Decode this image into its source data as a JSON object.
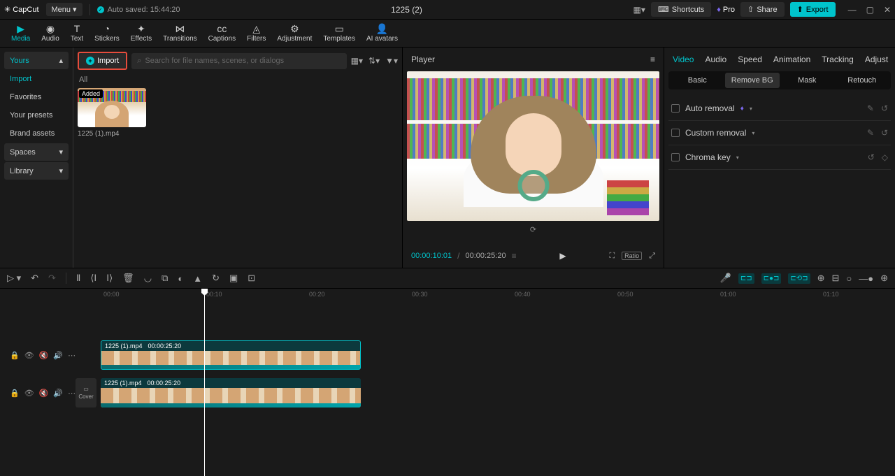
{
  "titlebar": {
    "logo": "CapCut",
    "menu": "Menu",
    "autosave": "Auto saved: 15:44:20",
    "project_title": "1225 (2)",
    "shortcuts": "Shortcuts",
    "pro": "Pro",
    "share": "Share",
    "export": "Export"
  },
  "toolbar": {
    "items": [
      "Media",
      "Audio",
      "Text",
      "Stickers",
      "Effects",
      "Transitions",
      "Captions",
      "Filters",
      "Adjustment",
      "Templates",
      "AI avatars"
    ],
    "active_index": 0
  },
  "sidebar": {
    "yours": "Yours",
    "items": [
      "Import",
      "Favorites",
      "Your presets",
      "Brand assets"
    ],
    "active_index": 0,
    "spaces": "Spaces",
    "library": "Library"
  },
  "media": {
    "import_btn": "Import",
    "search_placeholder": "Search for file names, scenes, or dialogs",
    "all_label": "All",
    "thumb_badge": "Added",
    "thumb_name": "1225 (1).mp4"
  },
  "player": {
    "title": "Player",
    "time_current": "00:00:10:01",
    "time_total": "00:00:25:20",
    "ratio": "Ratio"
  },
  "inspector": {
    "tabs": [
      "Video",
      "Audio",
      "Speed",
      "Animation",
      "Tracking",
      "Adjust"
    ],
    "active_tab": 0,
    "subtabs": [
      "Basic",
      "Remove BG",
      "Mask",
      "Retouch"
    ],
    "active_subtab": 1,
    "auto_removal": "Auto removal",
    "custom_removal": "Custom removal",
    "chroma_key": "Chroma key"
  },
  "timeline": {
    "ruler": [
      "00:00",
      "00:10",
      "00:20",
      "00:30",
      "00:40",
      "00:50",
      "01:00",
      "01:10"
    ],
    "clip1_name": "1225 (1).mp4",
    "clip1_dur": "00:00:25:20",
    "clip2_name": "1225 (1).mp4",
    "clip2_dur": "00:00:25:20",
    "cover": "Cover"
  }
}
